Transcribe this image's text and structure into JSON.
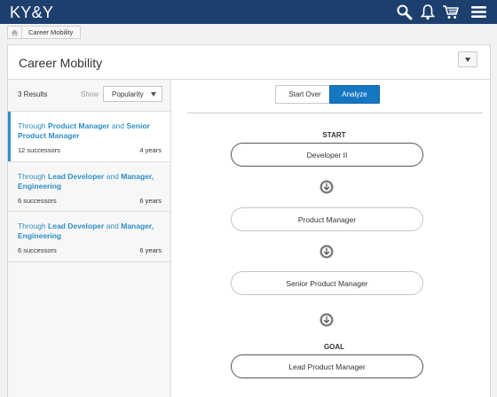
{
  "app": {
    "logo": "KY&Y",
    "icons": [
      "search-icon",
      "bell-icon",
      "cart-icon",
      "menu-icon"
    ],
    "colors": {
      "header": "#1d3f6e",
      "accent": "#2d8ec6",
      "primary_button": "#1577c2"
    }
  },
  "breadcrumb": {
    "home_icon": "home-icon",
    "label": "Career Mobility"
  },
  "panel": {
    "title": "Career Mobility",
    "toggle_icon": "chevron-down-icon"
  },
  "filters": {
    "results_label": "3 Results",
    "show_label": "Show",
    "sort_value": "Popularity"
  },
  "paths": [
    {
      "prefix": "Through ",
      "role1": "Product Manager",
      "joiner": " and ",
      "role2": "Senior Product Manager",
      "successors": "12 successors",
      "years": "4 years",
      "selected": true
    },
    {
      "prefix": "Through ",
      "role1": "Lead Developer",
      "joiner": " and ",
      "role2": "Manager, Engineering",
      "successors": "6 successors",
      "years": "6 years",
      "selected": false
    },
    {
      "prefix": "Through ",
      "role1": "Lead Developer",
      "joiner": " and ",
      "role2": "Manager, Engineering",
      "successors": "6 successors",
      "years": "6 years",
      "selected": false
    }
  ],
  "actions": {
    "start_over": "Start Over",
    "analyze": "Analyze"
  },
  "flow": {
    "start_label": "START",
    "goal_label": "GOAL",
    "steps": [
      "Developer II",
      "Product Manager",
      "Senior Product Manager"
    ],
    "goal": "Lead Product Manager"
  }
}
